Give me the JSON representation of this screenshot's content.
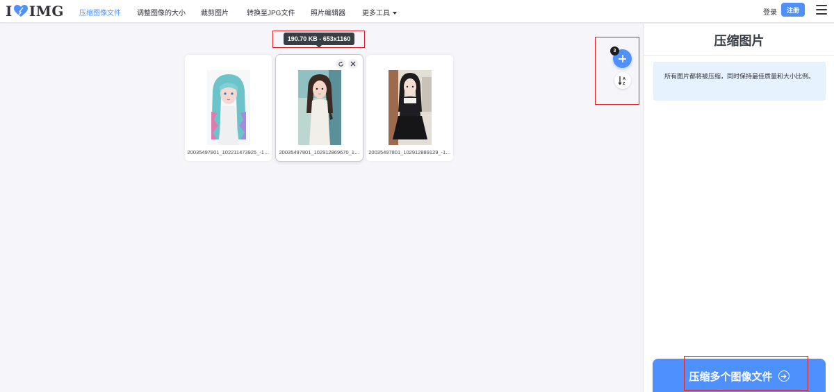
{
  "header": {
    "logo_left": "I",
    "logo_right": "IMG",
    "nav": [
      {
        "label": "压缩图像文件",
        "active": true
      },
      {
        "label": "调整图像的大小",
        "active": false
      },
      {
        "label": "裁剪图片",
        "active": false
      },
      {
        "label": "转换至JPG文件",
        "active": false
      },
      {
        "label": "照片编辑器",
        "active": false
      },
      {
        "label": "更多工具",
        "active": false
      }
    ],
    "login": "登录",
    "signup": "注册"
  },
  "workspace": {
    "tooltip": "190.70 KB - 653x1160",
    "file_count": "3",
    "files": [
      {
        "name": "20035497801_102211473925_-1…"
      },
      {
        "name": "20035497801_102912869670_1…"
      },
      {
        "name": "20035497801_102912889129_-1…"
      }
    ]
  },
  "sidebar": {
    "title": "压缩图片",
    "info": "所有图片都将被压缩，同时保持最佳质量和大小比例。",
    "compress_button": "压缩多个图像文件"
  },
  "colors": {
    "accent": "#4d90fe",
    "info_bg": "#e6f2fd",
    "workspace_bg": "#f5f5fa",
    "annotation": "#e02020"
  }
}
